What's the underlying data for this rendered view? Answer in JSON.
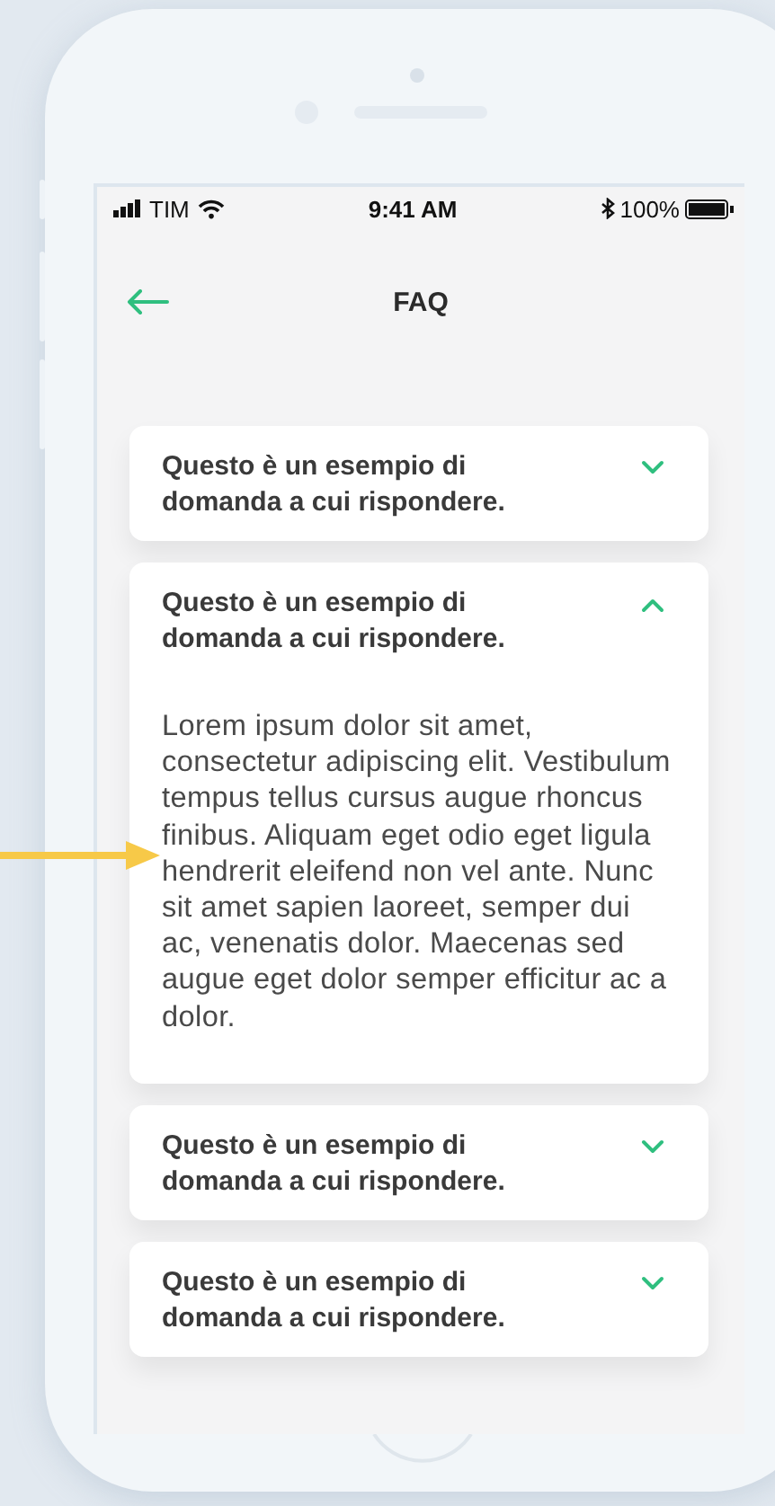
{
  "status_bar": {
    "carrier": "TIM",
    "time": "9:41 AM",
    "battery": "100%"
  },
  "header": {
    "title": "FAQ"
  },
  "faq": [
    {
      "question": "Questo è un esempio di domanda a cui rispondere.",
      "expanded": false
    },
    {
      "question": "Questo è un esempio di domanda a cui rispondere.",
      "expanded": true,
      "answer": "Lorem ipsum dolor sit amet, consectetur adipiscing elit. Vestibulum tempus tellus cursus augue rhoncus finibus. Aliquam eget odio eget ligula hendrerit eleifend non vel ante. Nunc sit amet sapien laoreet, semper dui ac, venenatis dolor. Maecenas sed augue eget dolor semper efficitur ac a dolor."
    },
    {
      "question": "Questo è un esempio di domanda a cui rispondere.",
      "expanded": false
    },
    {
      "question": "Questo è un esempio di domanda a cui rispondere.",
      "expanded": false
    }
  ]
}
